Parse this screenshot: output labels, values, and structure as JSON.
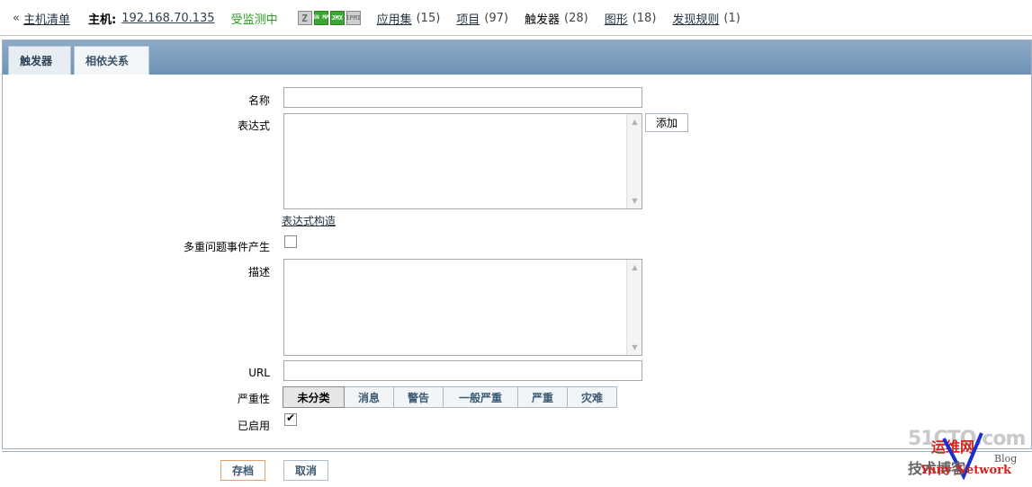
{
  "header": {
    "back_prefix": "«",
    "host_list": "主机清单",
    "host_label": "主机:",
    "host_ip": "192.168.70.135",
    "status": "受监测中",
    "icons": [
      "zabbix-agent-icon",
      "snmp-icon",
      "jmx-icon",
      "ipmi-icon"
    ],
    "icon_text": {
      "z": "Z",
      "snmp": "SN MP",
      "jmx": "JMX",
      "ipmi": "IPMI"
    },
    "nav": [
      {
        "label": "应用集",
        "count": "(15)",
        "link": true
      },
      {
        "label": "项目",
        "count": "(97)",
        "link": true
      },
      {
        "label": "触发器",
        "count": "(28)",
        "link": false
      },
      {
        "label": "图形",
        "count": "(18)",
        "link": true
      },
      {
        "label": "发现规则",
        "count": "(1)",
        "link": true
      }
    ],
    "status_color": "#2a9d1e"
  },
  "tabs": [
    {
      "label": "触发器",
      "active": true
    },
    {
      "label": "相依关系",
      "active": false
    }
  ],
  "form": {
    "name_label": "名称",
    "name_value": "",
    "expression_label": "表达式",
    "expression_value": "",
    "add_button": "添加",
    "expression_builder": "表达式构造",
    "multiple_events_label": "多重问题事件产生",
    "multiple_events_checked": false,
    "description_label": "描述",
    "description_value": "",
    "url_label": "URL",
    "url_value": "",
    "severity_label": "严重性",
    "severity_options": [
      "未分类",
      "消息",
      "警告",
      "一般严重",
      "严重",
      "灾难"
    ],
    "severity_selected": "未分类",
    "enabled_label": "已启用",
    "enabled_checked": true
  },
  "footer": {
    "save": "存档",
    "cancel": "取消"
  },
  "watermark": {
    "line1": "51CTO.com",
    "line2": "运维网",
    "line3": "技术博客",
    "line4": "Blog",
    "line5": "Yunv Network"
  }
}
